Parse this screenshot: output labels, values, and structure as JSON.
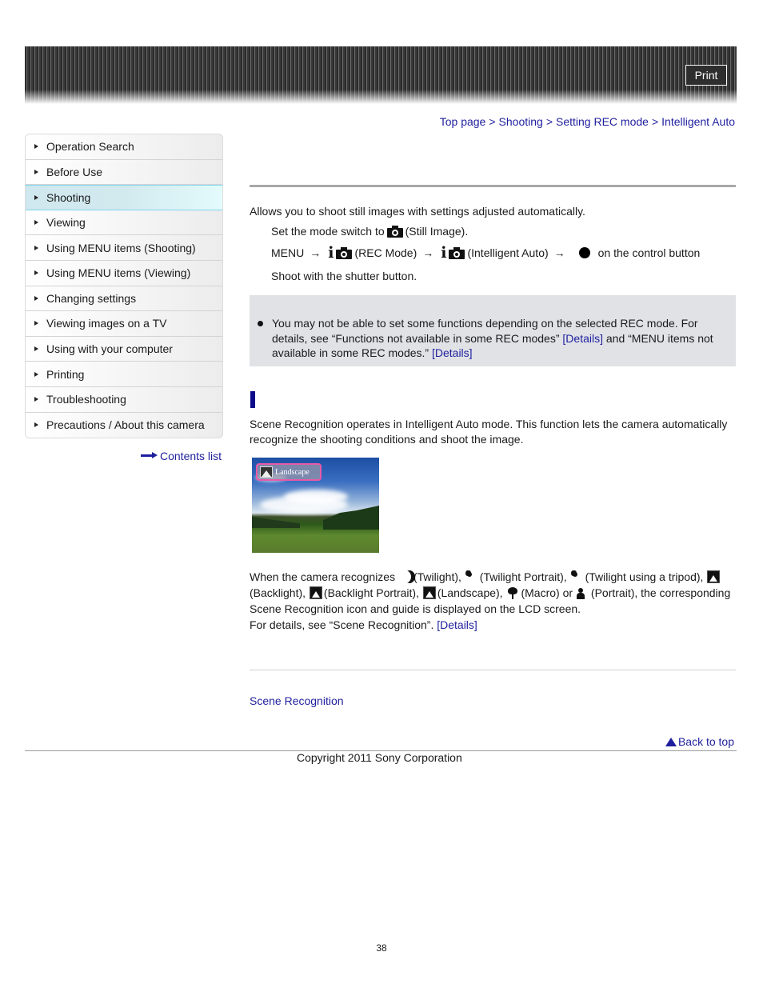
{
  "header": {
    "print_label": "Print"
  },
  "breadcrumb": [
    {
      "label": "Top page"
    },
    {
      "label": "Shooting"
    },
    {
      "label": "Setting REC mode"
    },
    {
      "label": "Intelligent Auto"
    }
  ],
  "breadcrumb_separator": ">",
  "sidebar": {
    "items": [
      {
        "label": "Operation Search",
        "active": false
      },
      {
        "label": "Before Use",
        "active": false
      },
      {
        "label": "Shooting",
        "active": true
      },
      {
        "label": "Viewing",
        "active": false
      },
      {
        "label": "Using MENU items (Shooting)",
        "active": false
      },
      {
        "label": "Using MENU items (Viewing)",
        "active": false
      },
      {
        "label": "Changing settings",
        "active": false
      },
      {
        "label": "Viewing images on a TV",
        "active": false
      },
      {
        "label": "Using with your computer",
        "active": false
      },
      {
        "label": "Printing",
        "active": false
      },
      {
        "label": "Troubleshooting",
        "active": false
      },
      {
        "label": "Precautions / About this camera",
        "active": false
      }
    ],
    "contents_list_label": "Contents list"
  },
  "main": {
    "intro": "Allows you to shoot still images with settings adjusted automatically.",
    "steps": {
      "step1_a": "Set the mode switch to",
      "step1_b": "(Still Image).",
      "step2_menu": "MENU",
      "step2_arrow": "→",
      "step2_rec_mode": "(REC Mode)",
      "step2_intelligent_auto": "(Intelligent Auto)",
      "step2_control": "on the control button",
      "step3": "Shoot with the shutter button."
    },
    "note": {
      "text_a": "You may not be able to set some functions depending on the selected REC mode. For details, see “Functions not available in some REC modes”",
      "link1": "[Details]",
      "text_b": "and “MENU items not available in some REC modes.”",
      "link2": "[Details]"
    },
    "scene_intro": "Scene Recognition operates in Intelligent Auto mode. This function lets the camera automatically recognize the shooting conditions and shoot the image.",
    "photo_label": "Landscape",
    "scene_text": {
      "lead": "When the camera recognizes",
      "twilight": "(Twilight),",
      "twilight_portrait": "(Twilight Portrait),",
      "twilight_tripod": "(Twilight using a tripod),",
      "backlight": "(Backlight),",
      "backlight_portrait": "(Backlight Portrait),",
      "landscape": "(Landscape),",
      "macro": "(Macro) or",
      "portrait": "(Portrait), the",
      "tail": "corresponding Scene Recognition icon and guide is displayed on the LCD screen.",
      "details_text": "For details, see “Scene Recognition”.",
      "details_link": "[Details]"
    },
    "related_link": "Scene Recognition"
  },
  "footer": {
    "back_to_top": "Back to top",
    "copyright": "Copyright 2011 Sony Corporation",
    "page_number": "38"
  },
  "colors": {
    "link": "#1f1f9e",
    "section_bar": "#0a0a8a",
    "note_bg": "#e0e2e6",
    "active_item": "#cfe7ee"
  }
}
